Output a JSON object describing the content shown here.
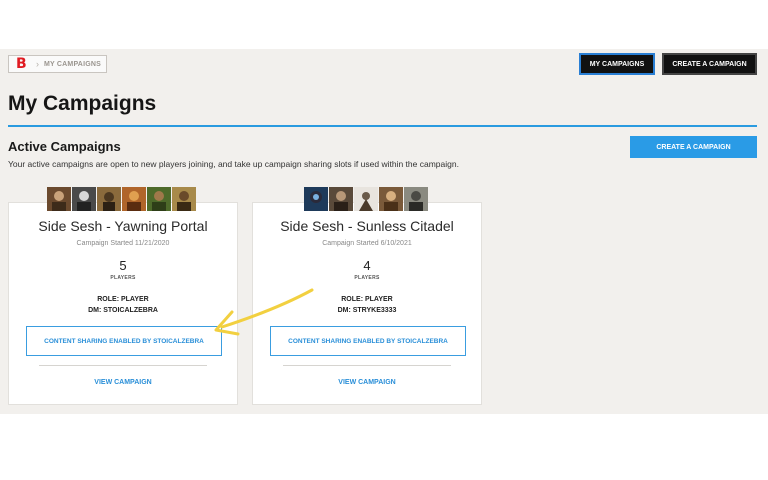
{
  "breadcrumb": {
    "logo": "B",
    "separator": "›",
    "current": "MY CAMPAIGNS"
  },
  "topnav": {
    "my_campaigns": "MY CAMPAIGNS",
    "create_campaign": "CREATE A CAMPAIGN"
  },
  "page_title": "My Campaigns",
  "section": {
    "title": "Active Campaigns",
    "description": "Your active campaigns are open to new players joining, and take up campaign sharing slots if used within the campaign.",
    "create_button": "CREATE A CAMPAIGN"
  },
  "campaigns": [
    {
      "name": "Side Sesh - Yawning Portal",
      "started": "Campaign Started 11/21/2020",
      "player_count": "5",
      "players_label": "PLAYERS",
      "role": "ROLE: PLAYER",
      "dm": "DM: STOICALZEBRA",
      "sharing": "CONTENT SHARING ENABLED BY STOICALZEBRA",
      "view": "VIEW CAMPAIGN"
    },
    {
      "name": "Side Sesh - Sunless Citadel",
      "started": "Campaign Started 6/10/2021",
      "player_count": "4",
      "players_label": "PLAYERS",
      "role": "ROLE: PLAYER",
      "dm": "DM: STRYKE3333",
      "sharing": "CONTENT SHARING ENABLED BY STOICALZEBRA",
      "view": "VIEW CAMPAIGN"
    }
  ],
  "colors": {
    "brand_red": "#e01b22",
    "accent_blue": "#2a9be6",
    "annotation_arrow": "#f2d040"
  }
}
